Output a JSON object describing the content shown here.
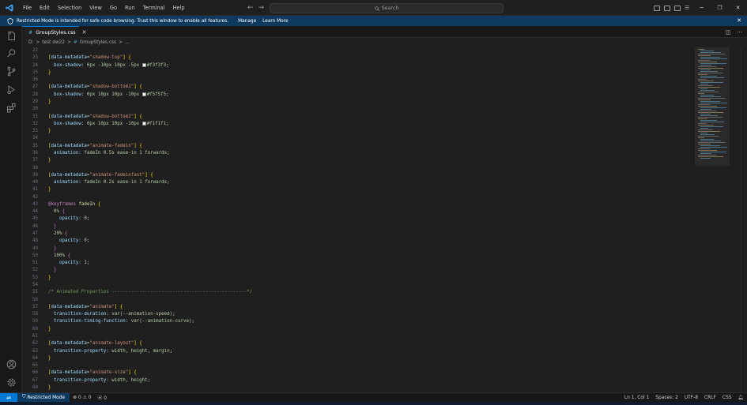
{
  "titlebar": {
    "menu": [
      "File",
      "Edit",
      "Selection",
      "View",
      "Go",
      "Run",
      "Terminal",
      "Help"
    ],
    "search_placeholder": "Search"
  },
  "banner": {
    "message": "Restricted Mode is intended for safe code browsing. Trust this window to enable all features.",
    "manage": "Manage",
    "learn_more": "Learn More"
  },
  "tab": {
    "filename": "GroupStyles.css"
  },
  "breadcrumb": {
    "drive": "D:",
    "folder": "test dw22",
    "file": "GroupStyles.css",
    "more": "..."
  },
  "code_lines": [
    {
      "n": "22"
    },
    {
      "n": "23",
      "sel": "[data-metadata=\"shadow-top\"] {"
    },
    {
      "n": "24",
      "prop": "box-shadow",
      "val": "0px -10px 10px -5px",
      "color": "#f3f3f3",
      "end": ";"
    },
    {
      "n": "25",
      "close": "}"
    },
    {
      "n": "26"
    },
    {
      "n": "27",
      "sel": "[data-metadata=\"shadow-bottom1\"] {"
    },
    {
      "n": "28",
      "prop": "box-shadow",
      "val": "0px 10px 10px -10px",
      "color": "#f5f5f5",
      "end": ";"
    },
    {
      "n": "29",
      "close": "}"
    },
    {
      "n": "30"
    },
    {
      "n": "31",
      "sel": "[data-metadata=\"shadow-bottom2\"] {"
    },
    {
      "n": "32",
      "prop": "box-shadow",
      "val": "0px 10px 10px -10px",
      "color": "#f1f1f1",
      "end": ";"
    },
    {
      "n": "33",
      "close": "}"
    },
    {
      "n": "34"
    },
    {
      "n": "35",
      "sel": "[data-metadata=\"animate-fadein\"] {"
    },
    {
      "n": "36",
      "prop": "animation",
      "val": "fadeIn 0.5s ease-in 1 forwards",
      "end": ";"
    },
    {
      "n": "37",
      "close": "}"
    },
    {
      "n": "38"
    },
    {
      "n": "39",
      "sel": "[data-metadata=\"animate-fadeinfast\"] {"
    },
    {
      "n": "40",
      "prop": "animation",
      "val": "fadeIn 0.2s ease-in 1 forwards",
      "end": ";"
    },
    {
      "n": "41",
      "close": "}"
    },
    {
      "n": "42"
    },
    {
      "n": "43",
      "kf": "@keyframes",
      "kfname": "fadeIn",
      "open": "{"
    },
    {
      "n": "44",
      "indent": 1,
      "step": "0%",
      "open": "{"
    },
    {
      "n": "45",
      "indent": 2,
      "prop": "opacity",
      "val": "0",
      "end": ";"
    },
    {
      "n": "46",
      "indent": 1,
      "close": "}"
    },
    {
      "n": "47",
      "indent": 1,
      "step": "20%",
      "open": "{"
    },
    {
      "n": "48",
      "indent": 2,
      "prop": "opacity",
      "val": "0",
      "end": ";"
    },
    {
      "n": "49",
      "indent": 1,
      "close": "}"
    },
    {
      "n": "50",
      "indent": 1,
      "step": "100%",
      "open": "{"
    },
    {
      "n": "51",
      "indent": 2,
      "prop": "opacity",
      "val": "1",
      "end": ";"
    },
    {
      "n": "52",
      "indent": 1,
      "close": "}"
    },
    {
      "n": "53",
      "close": "}"
    },
    {
      "n": "54"
    },
    {
      "n": "55",
      "comment": "/* Animated Properties -------------------------------------------------*/"
    },
    {
      "n": "56"
    },
    {
      "n": "57",
      "sel": "[data-metadata=\"animate\"] {"
    },
    {
      "n": "58",
      "prop": "transition-duration",
      "val": "var(--animation-speed)",
      "end": ";"
    },
    {
      "n": "59",
      "prop": "transition-timing-function",
      "val": "var(--animation-curve)",
      "end": ";"
    },
    {
      "n": "60",
      "close": "}"
    },
    {
      "n": "61"
    },
    {
      "n": "62",
      "sel": "[data-metadata=\"animate-layout\"] {"
    },
    {
      "n": "63",
      "prop": "transition-property",
      "val": "width, height, margin",
      "end": ";"
    },
    {
      "n": "64",
      "close": "}"
    },
    {
      "n": "65"
    },
    {
      "n": "66",
      "sel": "[data-metadata=\"animate-size\"] {"
    },
    {
      "n": "67",
      "prop": "transition-property",
      "val": "width, height",
      "end": ";"
    },
    {
      "n": "68",
      "close": "}"
    }
  ],
  "statusbar": {
    "restricted": "Restricted Mode",
    "errors": "0",
    "warnings": "0",
    "ports": "0",
    "position": "Ln 1, Col 1",
    "spaces": "Spaces: 2",
    "encoding": "UTF-8",
    "eol": "CRLF",
    "language": "CSS"
  },
  "colors": {
    "accent": "#0078d4",
    "banner": "#0e3a5f"
  }
}
